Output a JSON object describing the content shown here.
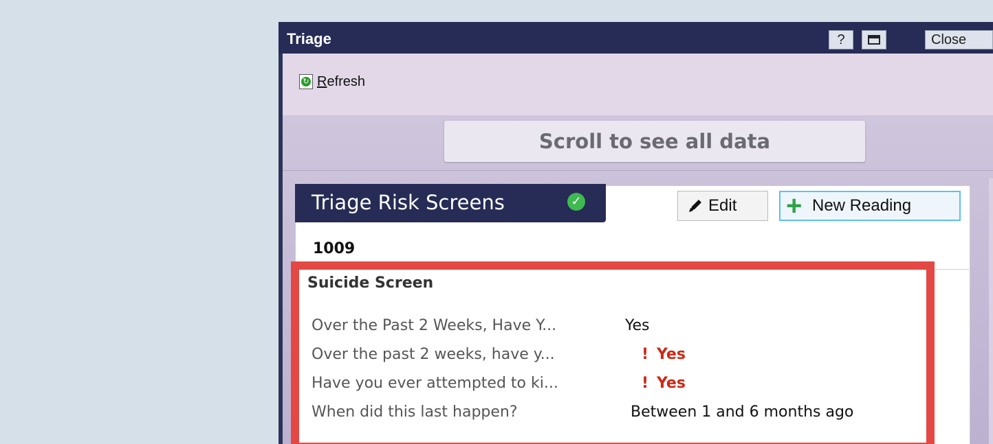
{
  "window": {
    "title": "Triage",
    "help_label": "?",
    "close_label": "Close"
  },
  "toolbar": {
    "refresh_mnemonic": "R",
    "refresh_rest": "efresh"
  },
  "scroll_hint": "Scroll to see all data",
  "panel": {
    "title": "Triage Risk Screens",
    "edit_label": "Edit",
    "new_reading_label": "New Reading",
    "record_id": "1009"
  },
  "suicide_screen": {
    "title": "Suicide Screen",
    "rows": [
      {
        "question": "Over the Past 2 Weeks, Have Y...",
        "answer": "Yes",
        "flagged": false
      },
      {
        "question": "Over the past 2 weeks, have y...",
        "answer": "Yes",
        "flagged": true
      },
      {
        "question": "Have you ever attempted to ki...",
        "answer": "Yes",
        "flagged": true
      },
      {
        "question": "When did this last happen?",
        "answer": "Between 1 and 6 months ago",
        "flagged": false
      }
    ],
    "flag_symbol": "!"
  },
  "colors": {
    "title_bar": "#262c55",
    "highlight": "#e44844",
    "flag": "#cc2a16",
    "check": "#3fb950",
    "plus": "#2ea24a"
  },
  "icons": {
    "refresh": "refresh-icon",
    "check": "check-circle-icon",
    "edit": "pencil-icon",
    "new": "plus-icon",
    "maximize": "maximize-icon"
  }
}
